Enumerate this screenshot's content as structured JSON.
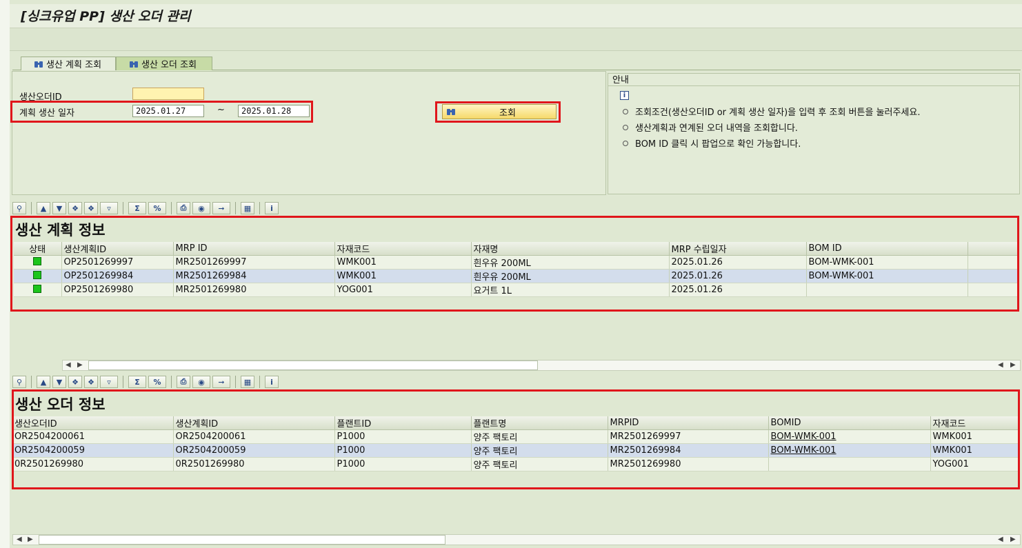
{
  "title": "[싱크유업 PP] 생산 오더 관리",
  "tabs": [
    {
      "label": "생산 계획 조회"
    },
    {
      "label": "생산 오더 조회"
    }
  ],
  "search": {
    "order_id_label": "생산오더ID",
    "order_id_value": "",
    "date_label": "계획 생산 일자",
    "date_from": "2025.01.27",
    "date_sep": "~",
    "date_to": "2025.01.28",
    "button_label": "조회"
  },
  "guide": {
    "title": "안내",
    "lines": [
      "조회조건(생산오더ID or 계획 생산 일자)을 입력 후 조회 버튼을 눌러주세요.",
      "생산계획과 연계된 오더 내역을 조회합니다.",
      "BOM ID 클릭 시 팝업으로 확인 가능합니다."
    ]
  },
  "plan_grid": {
    "title": "생산 계획 정보",
    "columns": [
      "상태",
      "생산계획ID",
      "MRP ID",
      "자재코드",
      "자재명",
      "MRP 수립일자",
      "BOM ID"
    ],
    "rows": [
      [
        "green",
        "OP2501269997",
        "MR2501269997",
        "WMK001",
        "흰우유 200ML",
        "2025.01.26",
        "BOM-WMK-001"
      ],
      [
        "green",
        "OP2501269984",
        "MR2501269984",
        "WMK001",
        "흰우유 200ML",
        "2025.01.26",
        "BOM-WMK-001"
      ],
      [
        "green",
        "OP2501269980",
        "MR2501269980",
        "YOG001",
        "요거트 1L",
        "2025.01.26",
        ""
      ]
    ],
    "status_color": "#1cc51c"
  },
  "order_grid": {
    "title": "생산 오더 정보",
    "columns": [
      "생산오더ID",
      "생산계획ID",
      "플랜트ID",
      "플랜트명",
      "MRPID",
      "BOMID",
      "자재코드"
    ],
    "rows": [
      [
        "OR2504200061",
        "OR2504200061",
        "P1000",
        "양주 팩토리",
        "MR2501269997",
        "BOM-WMK-001",
        "WMK001"
      ],
      [
        "OR2504200059",
        "OR2504200059",
        "P1000",
        "양주 팩토리",
        "MR2501269984",
        "BOM-WMK-001",
        "WMK001"
      ],
      [
        "0R2501269980",
        "0R2501269980",
        "P1000",
        "양주 팩토리",
        "MR2501269980",
        "",
        "YOG001"
      ]
    ]
  },
  "colors": {
    "highlight_box": "#e0161b",
    "selected_row": "#d3ddec",
    "background": "#dfe8d2"
  },
  "toolbar_icons": [
    "details-icon",
    "sort-asc-icon",
    "sort-desc-icon",
    "find-icon",
    "find-next-icon",
    "filter-icon",
    "sum-icon",
    "subtotal-icon",
    "print-icon",
    "views-icon",
    "export-icon",
    "layout-icon",
    "info-icon"
  ]
}
